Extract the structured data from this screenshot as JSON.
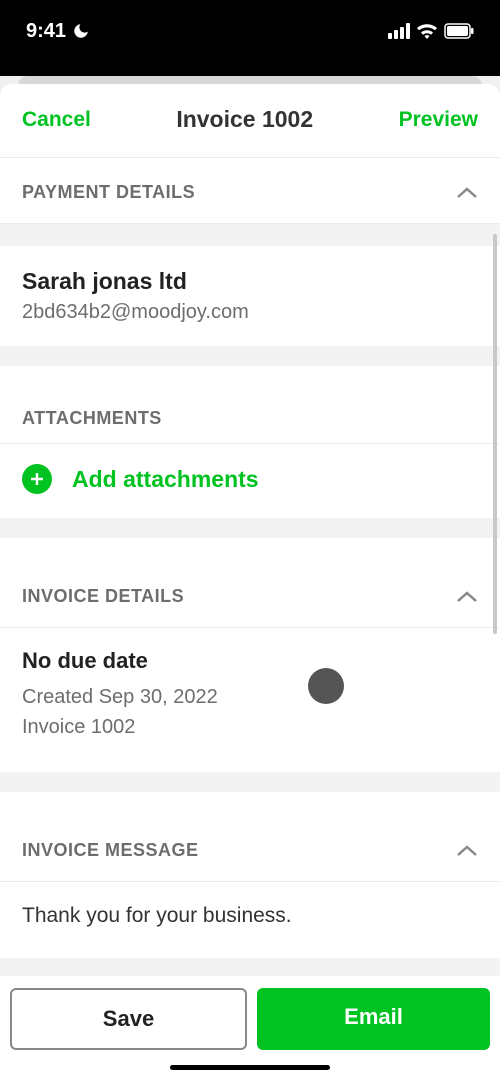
{
  "statusBar": {
    "time": "9:41"
  },
  "nav": {
    "cancel": "Cancel",
    "title": "Invoice 1002",
    "preview": "Preview"
  },
  "paymentDetails": {
    "header": "PAYMENT DETAILS",
    "customerName": "Sarah jonas ltd",
    "customerEmail": "2bd634b2@moodjoy.com"
  },
  "attachments": {
    "header": "ATTACHMENTS",
    "addLabel": "Add attachments"
  },
  "invoiceDetails": {
    "header": "INVOICE DETAILS",
    "dueDate": "No due date",
    "created": "Created Sep 30, 2022",
    "invoiceNumber": "Invoice 1002"
  },
  "invoiceMessage": {
    "header": "INVOICE MESSAGE",
    "text": "Thank you for your business."
  },
  "buttons": {
    "save": "Save",
    "email": "Email"
  }
}
